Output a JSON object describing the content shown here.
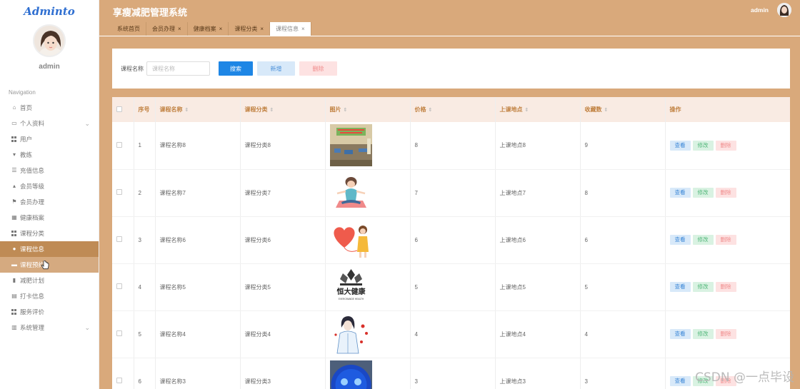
{
  "sidebar": {
    "logo": "Adminto",
    "username": "admin",
    "nav_caption": "Navigation",
    "items": [
      {
        "label": "首页",
        "icon": "home-icon"
      },
      {
        "label": "个人资料",
        "icon": "profile-icon",
        "expandable": true
      },
      {
        "label": "用户",
        "icon": "grid-icon"
      },
      {
        "label": "教练",
        "icon": "trophy-icon"
      },
      {
        "label": "充值信息",
        "icon": "list-icon"
      },
      {
        "label": "会员等级",
        "icon": "thumb-icon"
      },
      {
        "label": "会员办理",
        "icon": "flag-icon"
      },
      {
        "label": "健康档案",
        "icon": "table-icon"
      },
      {
        "label": "课程分类",
        "icon": "grid-icon"
      },
      {
        "label": "课程信息",
        "icon": "user-icon",
        "state": "active"
      },
      {
        "label": "课程预约",
        "icon": "monitor-icon",
        "state": "hover"
      },
      {
        "label": "减肥计划",
        "icon": "bar-icon"
      },
      {
        "label": "打卡信息",
        "icon": "card-icon"
      },
      {
        "label": "服务评价",
        "icon": "grid-icon"
      },
      {
        "label": "系统管理",
        "icon": "chart-icon",
        "expandable": true
      }
    ]
  },
  "topbar": {
    "title": "享瘦减肥管理系统",
    "admin_name": "admin"
  },
  "tabs": [
    {
      "label": "系统首页",
      "closable": false
    },
    {
      "label": "会员办理",
      "closable": true
    },
    {
      "label": "健康档案",
      "closable": true
    },
    {
      "label": "课程分类",
      "closable": true
    },
    {
      "label": "课程信息",
      "closable": true,
      "active": true
    }
  ],
  "search": {
    "label": "课程名称",
    "placeholder": "课程名称",
    "search_btn": "搜索",
    "add_btn": "新增",
    "delete_btn": "删除"
  },
  "table": {
    "headers": [
      "序号",
      "课程名称",
      "课程分类",
      "图片",
      "价格",
      "上课地点",
      "收藏数",
      "操作"
    ],
    "actions": {
      "view": "查看",
      "edit": "修改",
      "delete": "删除"
    },
    "rows": [
      {
        "no": "1",
        "name": "课程名称8",
        "category": "课程分类8",
        "image": "gym-room",
        "price": "8",
        "location": "上课地点8",
        "favorites": "9"
      },
      {
        "no": "2",
        "name": "课程名称7",
        "category": "课程分类7",
        "image": "yoga-girl",
        "price": "7",
        "location": "上课地点7",
        "favorites": "8"
      },
      {
        "no": "3",
        "name": "课程名称6",
        "category": "课程分类6",
        "image": "heart-balloon",
        "price": "6",
        "location": "上课地点6",
        "favorites": "6"
      },
      {
        "no": "4",
        "name": "课程名称5",
        "category": "课程分类5",
        "image": "evergrande-logo",
        "price": "5",
        "location": "上课地点5",
        "favorites": "5"
      },
      {
        "no": "5",
        "name": "课程名称4",
        "category": "课程分类4",
        "image": "doctor",
        "price": "4",
        "location": "上课地点4",
        "favorites": "4"
      },
      {
        "no": "6",
        "name": "课程名称3",
        "category": "课程分类3",
        "image": "blue-orb",
        "price": "3",
        "location": "上课地点3",
        "favorites": "3"
      }
    ],
    "logo_text_cn": "恒大健康",
    "logo_text_en": "EVERGRANDE HEALTH"
  },
  "watermark": "CSDN @一点毕设"
}
